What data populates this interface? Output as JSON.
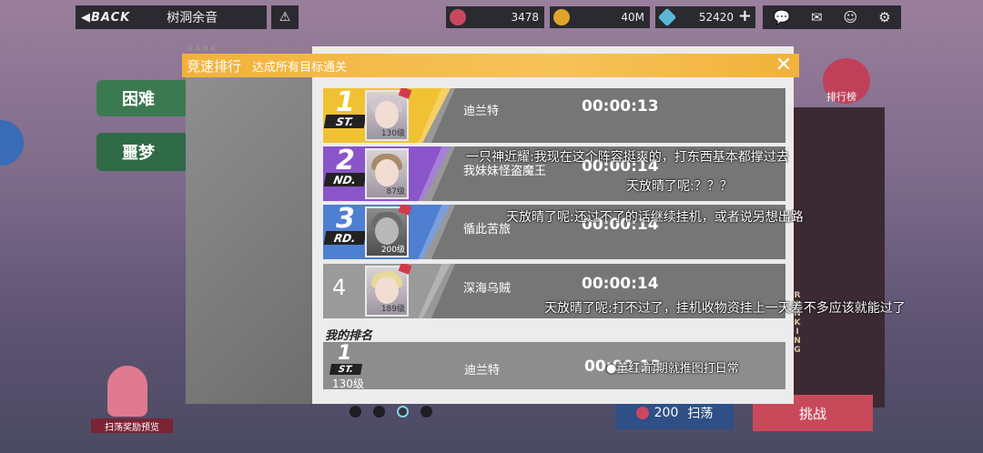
{
  "topbar": {
    "back_label": "◀BACK",
    "title": "树洞余音",
    "resources": [
      {
        "icon": "heart-stamina-icon",
        "value": "3478"
      },
      {
        "icon": "coin-icon",
        "value": "40M"
      },
      {
        "icon": "diamond-icon",
        "value": "52420"
      }
    ],
    "add_symbol": "+"
  },
  "background": {
    "side_card_1": "困难",
    "side_card_2": "噩梦",
    "ranking_badge_label": "排行榜",
    "ranking_vertical": "RANKING",
    "sweep_cost": "200",
    "sweep_label": "扫荡",
    "fight_label": "挑战",
    "sweep_preview_label": "扫荡奖励预览",
    "page_dots": 4,
    "active_dot": 3
  },
  "modal": {
    "watermark": "RANK",
    "title": "竞速排行",
    "subtitle": "达成所有目标通关",
    "close_symbol": "✕",
    "entries": [
      {
        "rank": "1",
        "suffix": "ST.",
        "name": "迪兰特",
        "time": "00:00:13",
        "level": "130级",
        "band_color": "#f0c233",
        "hair": "#cfc6cf"
      },
      {
        "rank": "2",
        "suffix": "ND.",
        "name": "我妹妹怪盗魔王",
        "time": "00:00:14",
        "level": "87级",
        "band_color": "#8a55c9",
        "hair": "#a88a68"
      },
      {
        "rank": "3",
        "suffix": "RD.",
        "name": "循此苦旅",
        "time": "00:00:14",
        "level": "200级",
        "band_color": "#4f7fd1",
        "hair": "#6b6b6b"
      },
      {
        "rank": "4",
        "suffix": "",
        "name": "深海乌贼",
        "time": "00:00:14",
        "level": "189级",
        "band_color": "#9a9a9a",
        "hair": "#e7d99a"
      }
    ],
    "my_rank_label": "我的排名",
    "my_entry": {
      "rank": "1",
      "suffix": "ST.",
      "level": "130级",
      "name": "迪兰特",
      "time": "00:00:13"
    }
  },
  "chat_messages": [
    "一只神近耀:我现在这个阵容挺爽的，打东西基本都撑过去",
    "天放晴了呢:？？？",
    "天放晴了呢:还过不了的话继续挂机，或者说另想出路",
    "天放晴了呢:打不过了，挂机收物资挂上一天差不多应该就能过了",
    "●董红:前期就推图打日常"
  ]
}
